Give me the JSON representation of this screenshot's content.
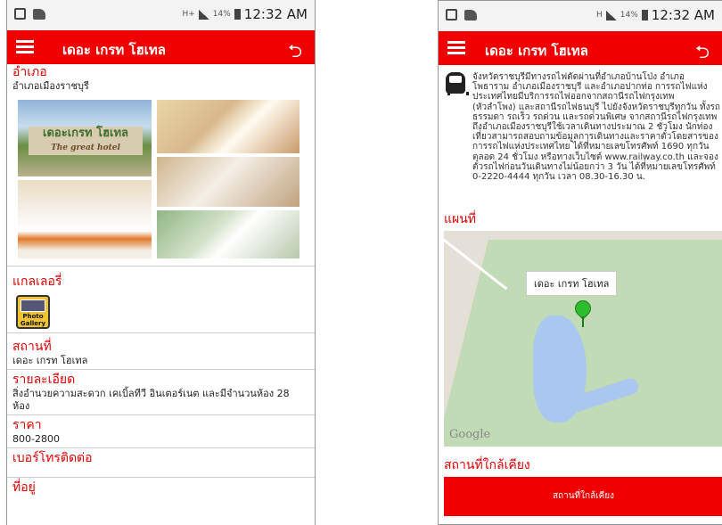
{
  "left_screen": {
    "status": {
      "network": "H+",
      "battery": "14%",
      "time": "12:32 AM"
    },
    "app_title": "เดอะ เกรท โฮเทล",
    "district_heading": "อำเภอ",
    "district_value": "อำเภอเมืองราชบุรี",
    "photo_sign": {
      "name": "เดอะเกรท โฮเทล",
      "sub": "The great hotel"
    },
    "gallery_heading": "แกลเลอรี่",
    "gallery_icon_label": "Photo Gallery",
    "place_heading": "สถานที่",
    "place_value": "เดอะ เกรท โฮเทล",
    "detail_heading": "รายละเอียด",
    "detail_value": "สิ่งอำนวยความสะดวก เคเบิ้ลทีวี อินเตอร์เนต และมีจำนวนห้อง 28 ห้อง",
    "price_heading": "ราคา",
    "price_value": "800-2800",
    "phone_heading": "เบอร์โทรติดต่อ",
    "address_heading": "ที่อยู่"
  },
  "right_screen": {
    "status": {
      "network": "H",
      "battery": "14%",
      "time": "12:32 AM"
    },
    "app_title": "เดอะ เกรท โฮเทล",
    "transport_text": "จังหวัดราชบุรีมีทางรถไฟตัดผ่านที่อำเภอบ้านโป่ง อำเภอโพธาราม อำเภอเมืองราชบุรี และอำเภอปากท่อ การรถไฟแห่งประเทศไทยมีบริการรถไฟออกจากสถานีรถไฟกรุงเทพ (หัวลำโพง) และสถานีรถไฟธนบุรี ไปยังจังหวัดราชบุรีทุกวัน ทั้งรถธรรมดา รถเร็ว รถด่วน และรถด่วนพิเศษ จากสถานีรถไฟกรุงเทพถึงอำเภอเมืองราชบุรีใช้เวลาเดินทางประมาณ 2 ชั่วโมง นักท่องเที่ยวสามารถสอบถามข้อมูลการเดินทางและราคาตั๋วโดยสารของการรถไฟแห่งประเทศไทย ได้ที่หมายเลขโทรศัพท์ 1690 ทุกวัน ตลอด 24 ชั่วโมง หรือทางเว็บไซต์ www.railway.co.th และจองตั๋วรถไฟก่อนวันเดินทางไม่น้อยกว่า 3 วัน ได้ที่หมายเลขโทรศัพท์ 0-2220-4444 ทุกวัน เวลา 08.30-16.30 น.",
    "map_heading": "แผนที่",
    "map_marker_label": "เดอะ เกรท โฮเทล",
    "map_provider": "Google",
    "nearby_heading": "สถานที่ใกล้เคียง",
    "nearby_button": "สถานที่ใกล้เคียง"
  },
  "colors": {
    "accent": "#f00000",
    "heading": "#e00000"
  }
}
